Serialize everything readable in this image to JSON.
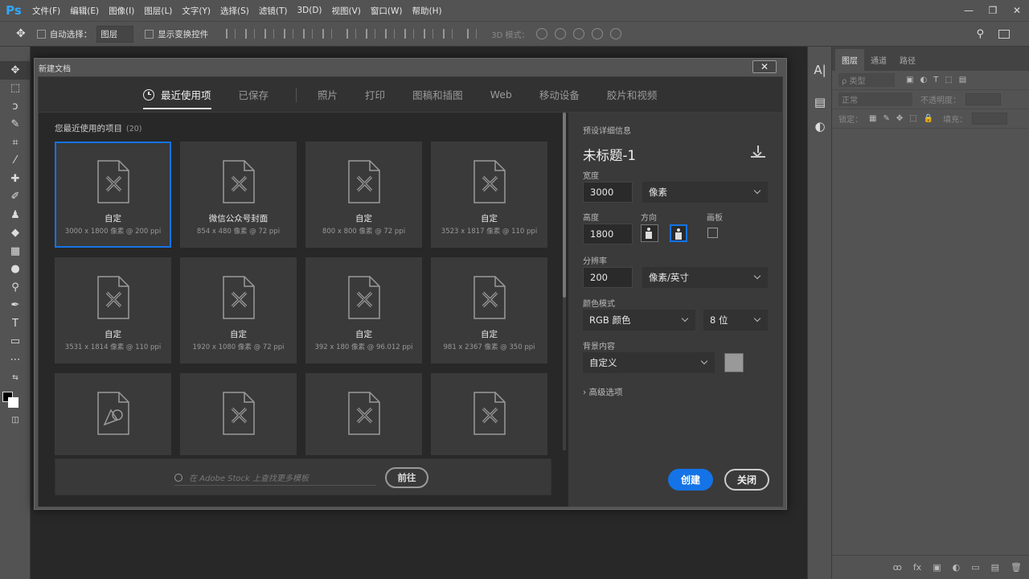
{
  "app": {
    "logo": "Ps",
    "menu": [
      "文件(F)",
      "编辑(E)",
      "图像(I)",
      "图层(L)",
      "文字(Y)",
      "选择(S)",
      "滤镜(T)",
      "3D(D)",
      "视图(V)",
      "窗口(W)",
      "帮助(H)"
    ],
    "window_controls": [
      "—",
      "❐",
      "✕"
    ]
  },
  "options_bar": {
    "auto_select_label": "自动选择：",
    "auto_select_value": "图层",
    "show_transform_label": "显示变换控件",
    "mode_3d_label": "3D 模式："
  },
  "layers_panel": {
    "tabs": [
      "图层",
      "通道",
      "路径"
    ],
    "kind_label": "ρ 类型",
    "blend_mode": "正常",
    "opacity_label": "不透明度：",
    "lock_label": "锁定：",
    "fill_label": "填充：",
    "footer_icons": [
      "ꝏ",
      "fx",
      "▣",
      "◐",
      "▭",
      "▤",
      "🗑"
    ]
  },
  "dialog": {
    "title": "新建文档",
    "close_glyph": "✕",
    "tabs": [
      "最近使用项",
      "已保存",
      "照片",
      "打印",
      "图稿和插图",
      "Web",
      "移动设备",
      "胶片和视频"
    ],
    "recent_heading": "您最近使用的项目",
    "recent_count": "(20)",
    "cards": [
      {
        "name": "自定",
        "dim": "3000 x 1800 像素 @ 200 ppi",
        "selected": true
      },
      {
        "name": "微信公众号封面",
        "dim": "854 x 480 像素 @ 72 ppi"
      },
      {
        "name": "自定",
        "dim": "800 x 800 像素 @ 72 ppi"
      },
      {
        "name": "自定",
        "dim": "3523 x 1817 像素 @ 110 ppi"
      },
      {
        "name": "自定",
        "dim": "3531 x 1814 像素 @ 110 ppi"
      },
      {
        "name": "自定",
        "dim": "1920 x 1080 像素 @ 72 ppi"
      },
      {
        "name": "自定",
        "dim": "392 x 180 像素 @ 96.012 ppi"
      },
      {
        "name": "自定",
        "dim": "981 x 2367 像素 @ 350 ppi"
      },
      {
        "name": "",
        "dim": ""
      },
      {
        "name": "",
        "dim": ""
      },
      {
        "name": "",
        "dim": ""
      },
      {
        "name": "",
        "dim": ""
      }
    ],
    "stock_placeholder": "在 Adobe Stock 上查找更多模板",
    "go_label": "前往",
    "preset": {
      "section_label": "预设详细信息",
      "doc_name": "未标题-1",
      "width_label": "宽度",
      "width_value": "3000",
      "width_unit": "像素",
      "height_label": "高度",
      "height_value": "1800",
      "orientation_label": "方向",
      "artboard_label": "画板",
      "resolution_label": "分辨率",
      "resolution_value": "200",
      "resolution_unit": "像素/英寸",
      "color_mode_label": "颜色模式",
      "color_mode_value": "RGB 颜色",
      "bit_depth": "8 位",
      "bg_label": "背景内容",
      "bg_value": "自定义",
      "bg_color": "#999999",
      "advanced_label": "高级选项",
      "create_label": "创建",
      "close_label": "关闭"
    }
  }
}
